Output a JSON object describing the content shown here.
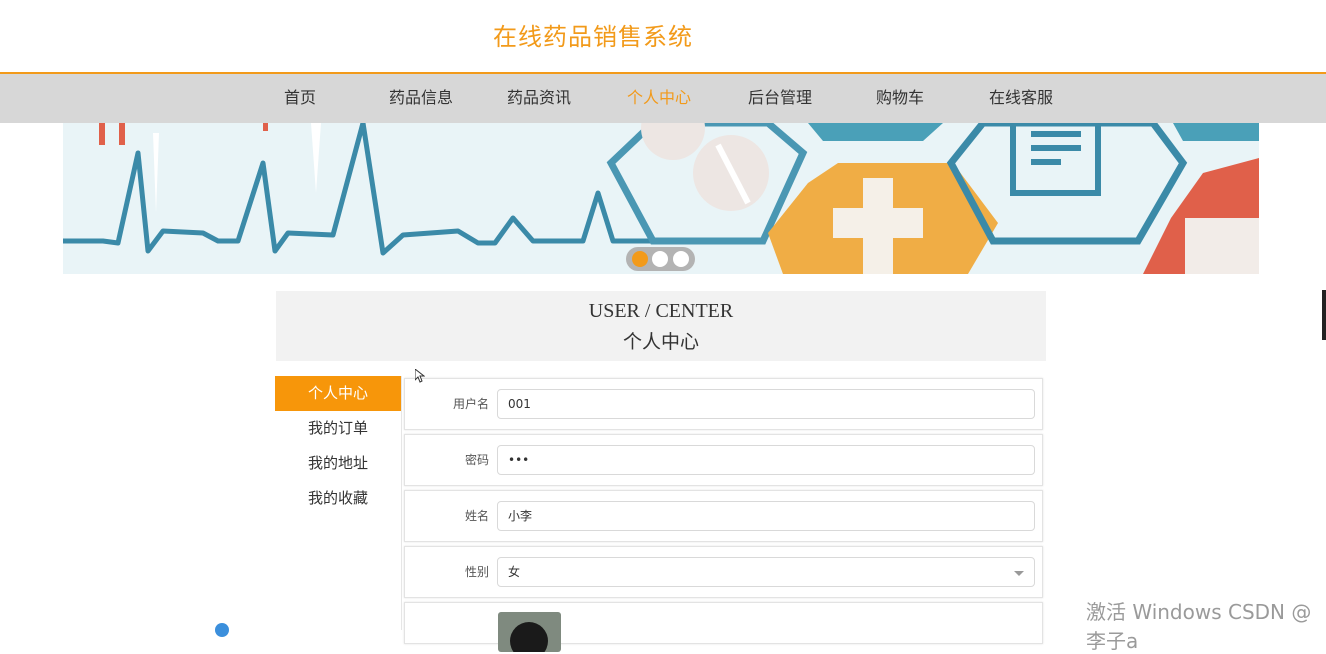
{
  "header": {
    "title": "在线药品销售系统"
  },
  "nav": {
    "items": [
      {
        "label": "首页"
      },
      {
        "label": "药品信息"
      },
      {
        "label": "药品资讯"
      },
      {
        "label": "个人中心"
      },
      {
        "label": "后台管理"
      },
      {
        "label": "购物车"
      },
      {
        "label": "在线客服"
      }
    ],
    "active": "个人中心"
  },
  "banner": {
    "slide_count": 3,
    "active_slide": 1
  },
  "user_center": {
    "title_en": "USER / CENTER",
    "title_cn": "个人中心"
  },
  "sidebar": {
    "items": [
      {
        "label": "个人中心"
      },
      {
        "label": "我的订单"
      },
      {
        "label": "我的地址"
      },
      {
        "label": "我的收藏"
      }
    ],
    "active": "个人中心"
  },
  "form": {
    "username": {
      "label": "用户名",
      "value": "001"
    },
    "password": {
      "label": "密码",
      "value": "•••"
    },
    "name": {
      "label": "姓名",
      "value": "小李"
    },
    "gender": {
      "label": "性别",
      "value": "女"
    }
  },
  "watermark": "激活 Windows   CSDN @李子a",
  "colors": {
    "accent": "#f29a1a",
    "nav_bg": "#d7d7d7"
  }
}
